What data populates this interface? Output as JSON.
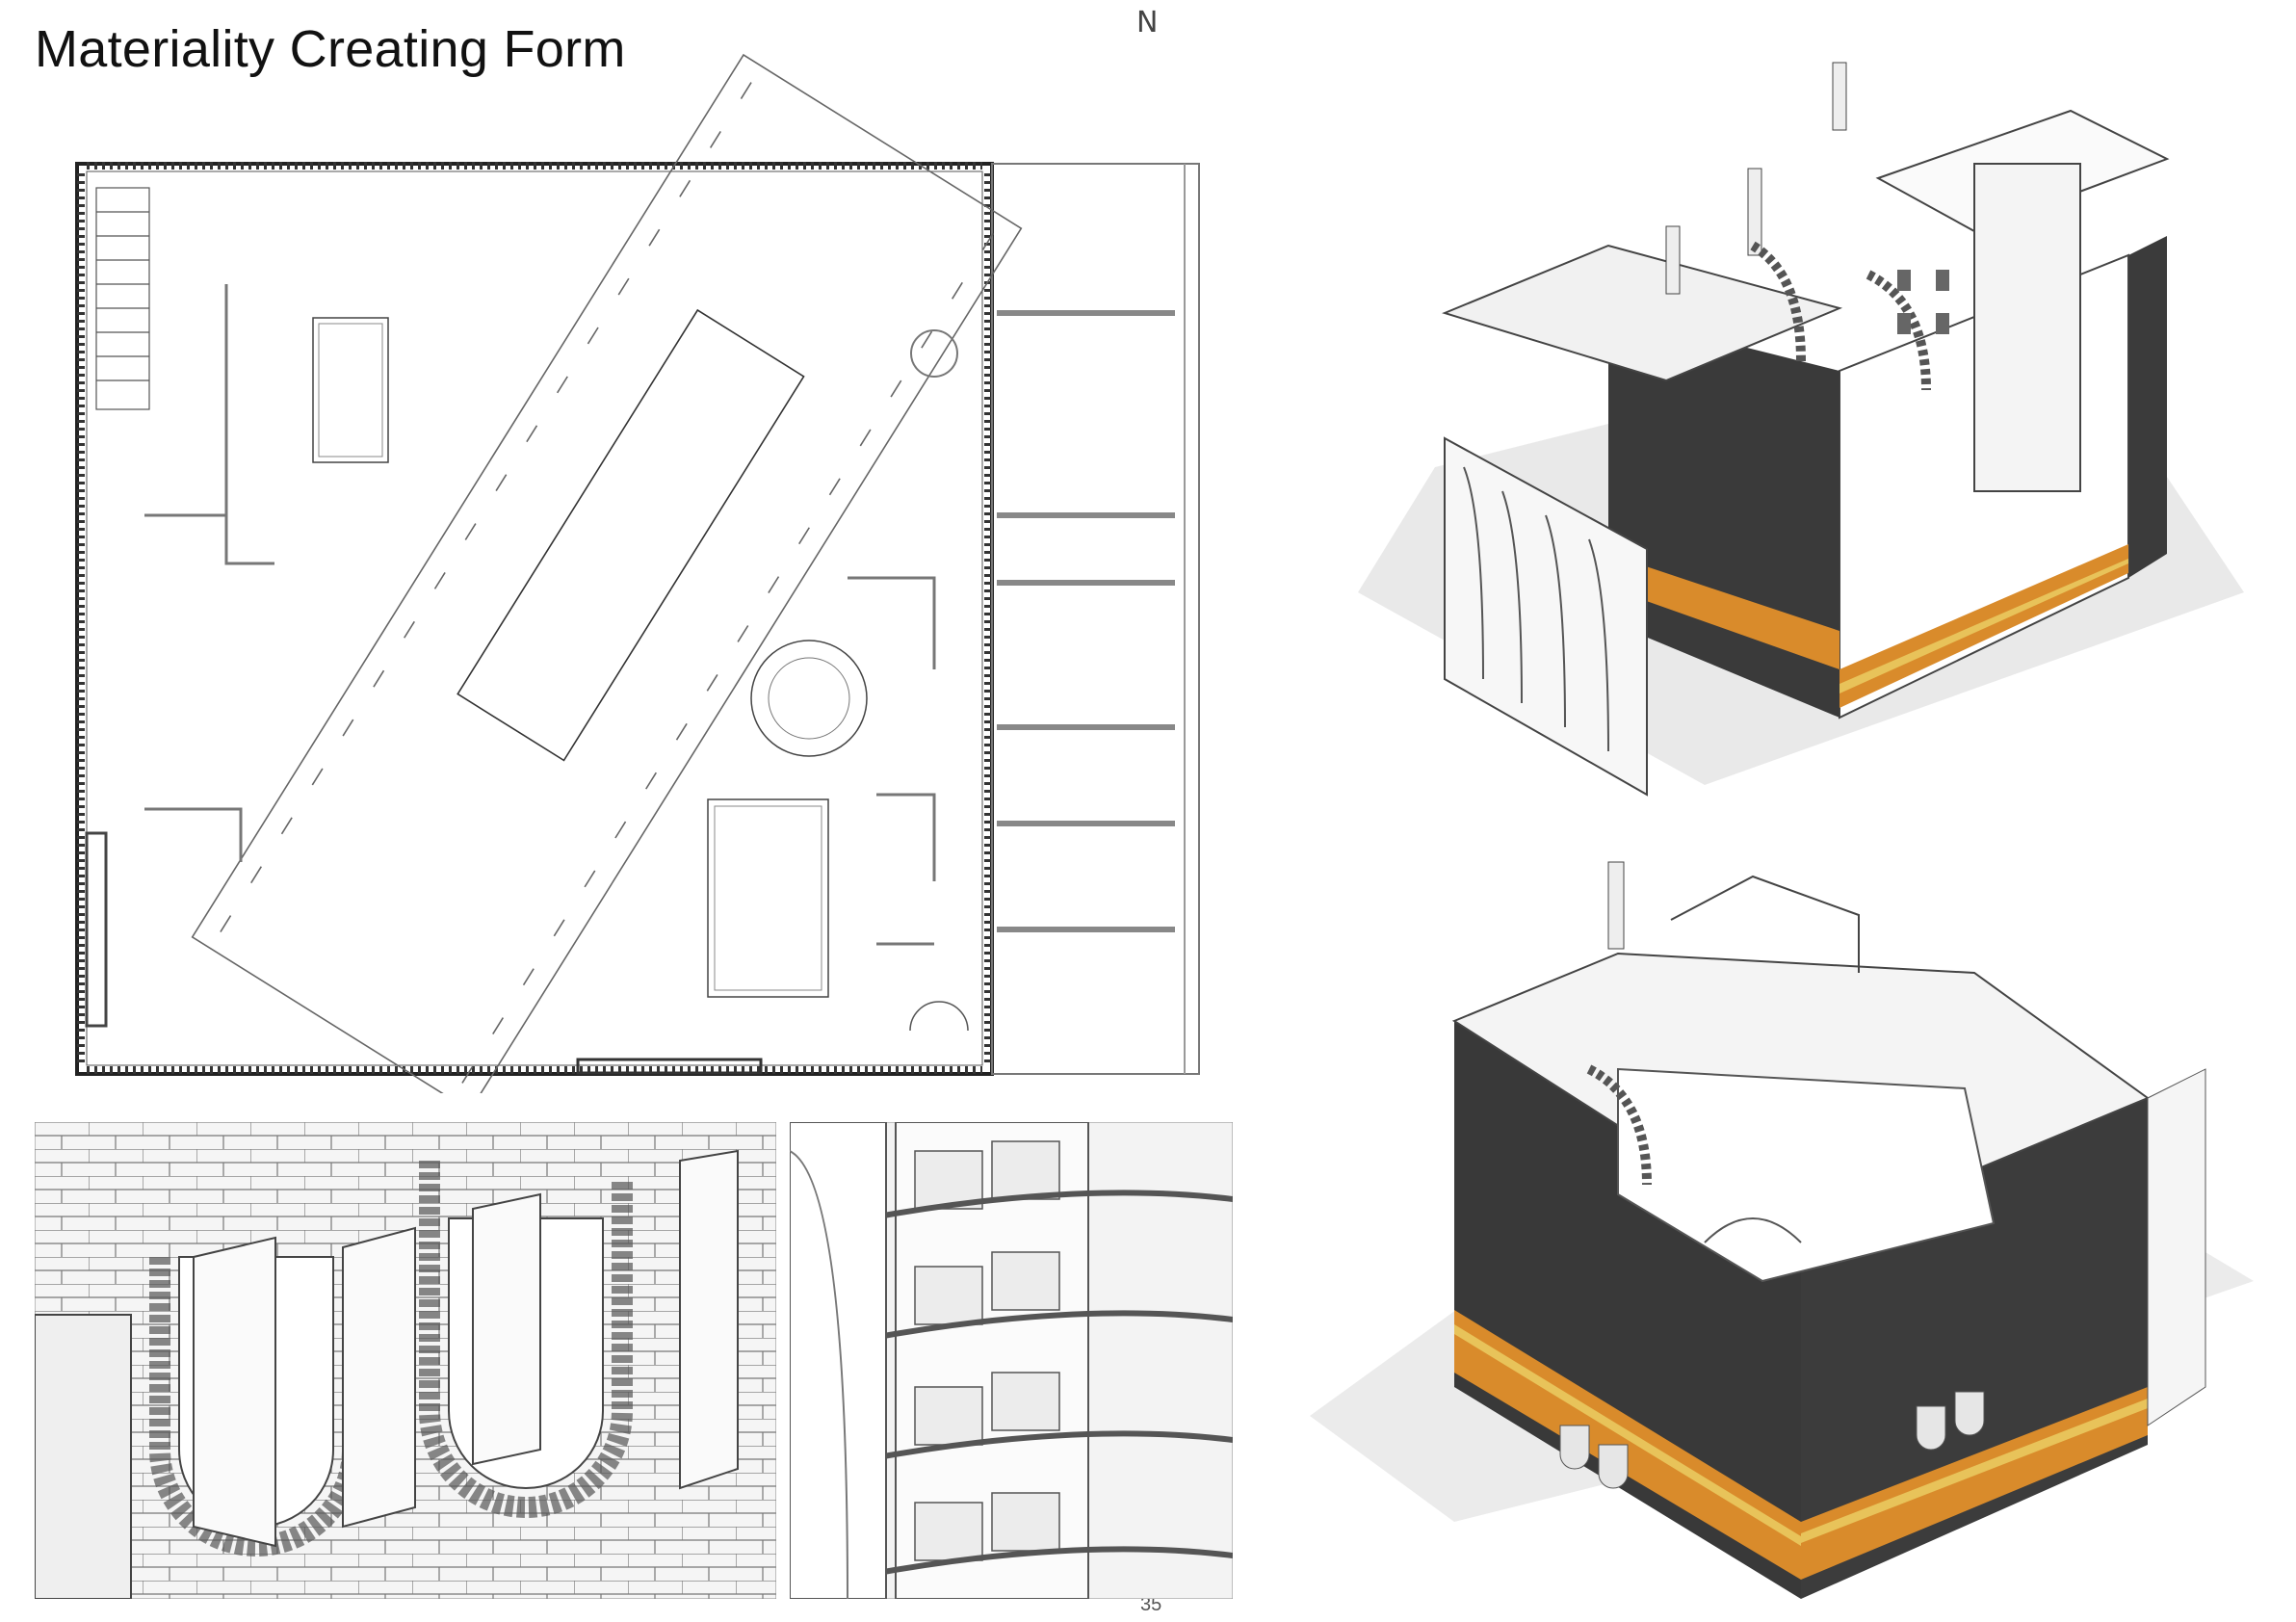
{
  "page": {
    "title": "Materiality Creating Form",
    "north_mark": "N",
    "page_number": "35"
  },
  "drawings": {
    "floor_plan": "plan",
    "axonometric_top": "axo-1",
    "axonometric_bottom": "axo-2",
    "detail_left": "brick-arch-detail",
    "detail_right": "spiral-stair-detail"
  },
  "colors": {
    "ink": "#111111",
    "line": "#555555",
    "brick_dark": "#3a3a3a",
    "band_orange": "#d98b2b",
    "band_yellow": "#e8c35a",
    "band_brown": "#8a5a2b",
    "paper": "#ffffff"
  }
}
